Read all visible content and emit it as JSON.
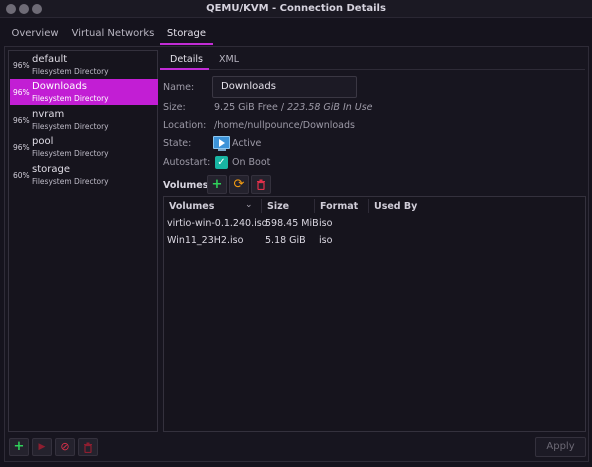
{
  "window": {
    "title": "QEMU/KVM - Connection Details"
  },
  "tabs": [
    {
      "label": "Overview"
    },
    {
      "label": "Virtual Networks"
    },
    {
      "label": "Storage"
    }
  ],
  "pools": [
    {
      "pct": "96%",
      "name": "default",
      "type": "Filesystem Directory"
    },
    {
      "pct": "96%",
      "name": "Downloads",
      "type": "Filesystem Directory"
    },
    {
      "pct": "96%",
      "name": "nvram",
      "type": "Filesystem Directory"
    },
    {
      "pct": "96%",
      "name": "pool",
      "type": "Filesystem Directory"
    },
    {
      "pct": "60%",
      "name": "storage",
      "type": "Filesystem Directory"
    }
  ],
  "subtabs": [
    {
      "label": "Details"
    },
    {
      "label": "XML"
    }
  ],
  "details": {
    "name_label": "Name:",
    "name_value": "Downloads",
    "size_label": "Size:",
    "size_free": "9.25 GiB Free",
    "size_sep": "/",
    "size_used": "223.58 GiB In Use",
    "location_label": "Location:",
    "location_value": "/home/nullpounce/Downloads",
    "state_label": "State:",
    "state_value": "Active",
    "autostart_label": "Autostart:",
    "autostart_value": "On Boot"
  },
  "volumes": {
    "header": "Volumes",
    "columns": [
      "Volumes",
      "Size",
      "Format",
      "Used By"
    ],
    "rows": [
      {
        "name": "virtio-win-0.1.240.iso",
        "size": "598.45 MiB",
        "format": "iso",
        "used_by": ""
      },
      {
        "name": "Win11_23H2.iso",
        "size": "5.18 GiB",
        "format": "iso",
        "used_by": ""
      }
    ]
  },
  "icons": {
    "add": "plus-icon",
    "refresh": "refresh-icon",
    "delete": "trash-icon",
    "start": "play-icon",
    "stop": "stop-icon",
    "sort": "chevron-down-icon",
    "state": "running-monitor-icon",
    "check": "checkmark-icon"
  },
  "colors": {
    "accent": "#c21ed4",
    "add": "#2fd15a",
    "refresh": "#f39c12",
    "danger": "#e0304a",
    "checkbox": "#18b5a3"
  },
  "buttons": {
    "apply": "Apply"
  }
}
